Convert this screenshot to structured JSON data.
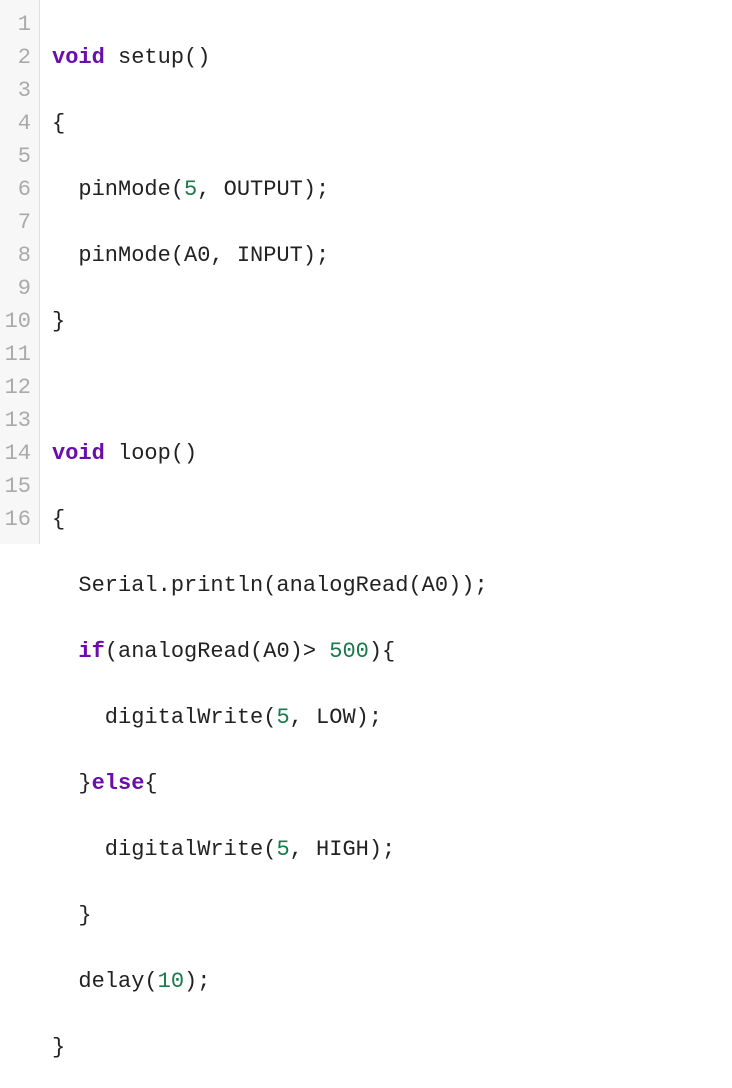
{
  "gutter": [
    "1",
    "2",
    "3",
    "4",
    "5",
    "6",
    "7",
    "8",
    "9",
    "10",
    "11",
    "12",
    "13",
    "14",
    "15",
    "16"
  ],
  "tokens": {
    "l1": {
      "a": "void",
      "b": " setup()"
    },
    "l2": {
      "a": "{"
    },
    "l3": {
      "a": "  pinMode(",
      "b": "5",
      "c": ", OUTPUT);"
    },
    "l4": {
      "a": "  pinMode(A0, INPUT);"
    },
    "l5": {
      "a": "}"
    },
    "l6": {
      "a": ""
    },
    "l7": {
      "a": "void",
      "b": " loop()"
    },
    "l8": {
      "a": "{"
    },
    "l9": {
      "a": "  Serial.println(analogRead(A0));"
    },
    "l10": {
      "a": "  ",
      "b": "if",
      "c": "(analogRead(A0)> ",
      "d": "500",
      "e": "){"
    },
    "l11": {
      "a": "    digitalWrite(",
      "b": "5",
      "c": ", LOW);"
    },
    "l12": {
      "a": "  }",
      "b": "else",
      "c": "{"
    },
    "l13": {
      "a": "    digitalWrite(",
      "b": "5",
      "c": ", HIGH);"
    },
    "l14": {
      "a": "  }"
    },
    "l15": {
      "a": "  delay(",
      "b": "10",
      "c": ");"
    },
    "l16": {
      "a": "}"
    }
  }
}
